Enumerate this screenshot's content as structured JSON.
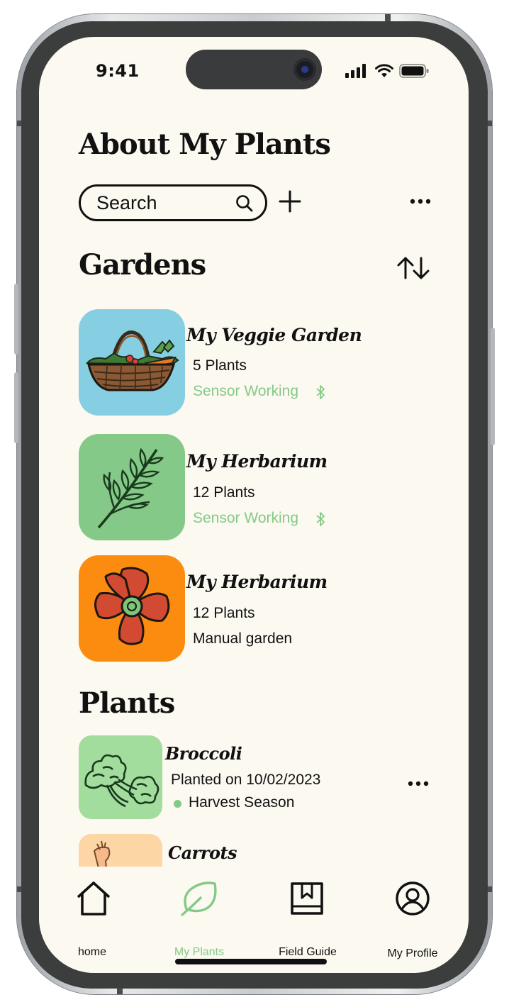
{
  "status": {
    "time": "9:41"
  },
  "header": {
    "title": "About My Plants"
  },
  "search": {
    "placeholder": "Search"
  },
  "sections": {
    "gardens": "Gardens",
    "plants": "Plants"
  },
  "gardens": [
    {
      "name": "My Veggie Garden",
      "count": "5 Plants",
      "status": "Sensor Working",
      "sensor": true,
      "image_icon": "vegetable-basket",
      "color": "#86cfe3"
    },
    {
      "name": "My Herbarium",
      "count": "12 Plants",
      "status": "Sensor Working",
      "sensor": true,
      "image_icon": "herb-sprig",
      "color": "#84c987"
    },
    {
      "name": "My Herbarium",
      "count": "12 Plants",
      "status": "Manual garden",
      "sensor": false,
      "image_icon": "red-flower",
      "color": "#fb8c0f"
    }
  ],
  "plants": [
    {
      "name": "Broccoli",
      "date": "Planted on 10/02/2023",
      "season": "Harvest Season",
      "image_icon": "broccoli",
      "color": "#a3dd9d"
    },
    {
      "name": "Carrots",
      "image_icon": "carrot",
      "color": "#fdd6a6"
    }
  ],
  "tabs": [
    {
      "label": "home",
      "icon": "house-icon",
      "active": false
    },
    {
      "label": "My Plants",
      "icon": "leaf-icon",
      "active": true
    },
    {
      "label": "Field Guide",
      "icon": "book-icon",
      "active": false
    },
    {
      "label": "My Profile",
      "icon": "user-circle-icon",
      "active": false
    }
  ],
  "colors": {
    "accent": "#84c987",
    "background": "#fcf9f1",
    "text": "#111111"
  }
}
